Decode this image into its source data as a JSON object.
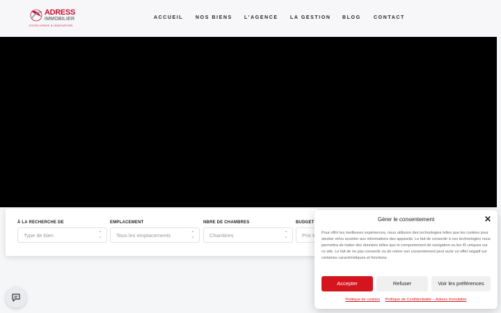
{
  "header": {
    "logo": {
      "brand": "ADRESS",
      "sub": "IMMOBILIER",
      "tagline": "EXCELLENCE & INNOVATION",
      "accent": "#c8102e"
    },
    "nav": [
      "ACCUEIL",
      "NOS BIENS",
      "L'AGENCE",
      "LA GESTION",
      "BLOG",
      "CONTACT"
    ]
  },
  "search": {
    "fields": [
      {
        "label": "À LA RECHERCHE DE",
        "placeholder": "Type de bien"
      },
      {
        "label": "EMPLACEMENT",
        "placeholder": "Tous les emplacements"
      },
      {
        "label": "NBRE DE CHAMBRES",
        "placeholder": "Chambres"
      },
      {
        "label": "BUDGET",
        "placeholder": "Prix M"
      }
    ]
  },
  "consent": {
    "title": "Gérer le consentement",
    "text": "Pour offrir les meilleures expériences, nous utilisons des technologies telles que les cookies pour stocker et/ou accéder aux informations des appareils. Le fait de consentir à ces technologies nous permettra de traiter des données telles que le comportement de navigation ou les ID uniques sur ce site. Le fait de ne pas consentir ou de retirer son consentement peut avoir un effet négatif sur certaines caractéristiques et fonctions.",
    "accept": "Accepter",
    "refuse": "Refuser",
    "preferences": "Voir les préférences",
    "link_cookies": "Politique de cookies",
    "link_privacy": "Politique de Confidentialité – Adress Immobilier",
    "accent": "#d4151e"
  },
  "icons": {
    "chat": "chat-bubble-icon",
    "close": "close-icon",
    "select_arrow": "updown-arrow-icon"
  }
}
